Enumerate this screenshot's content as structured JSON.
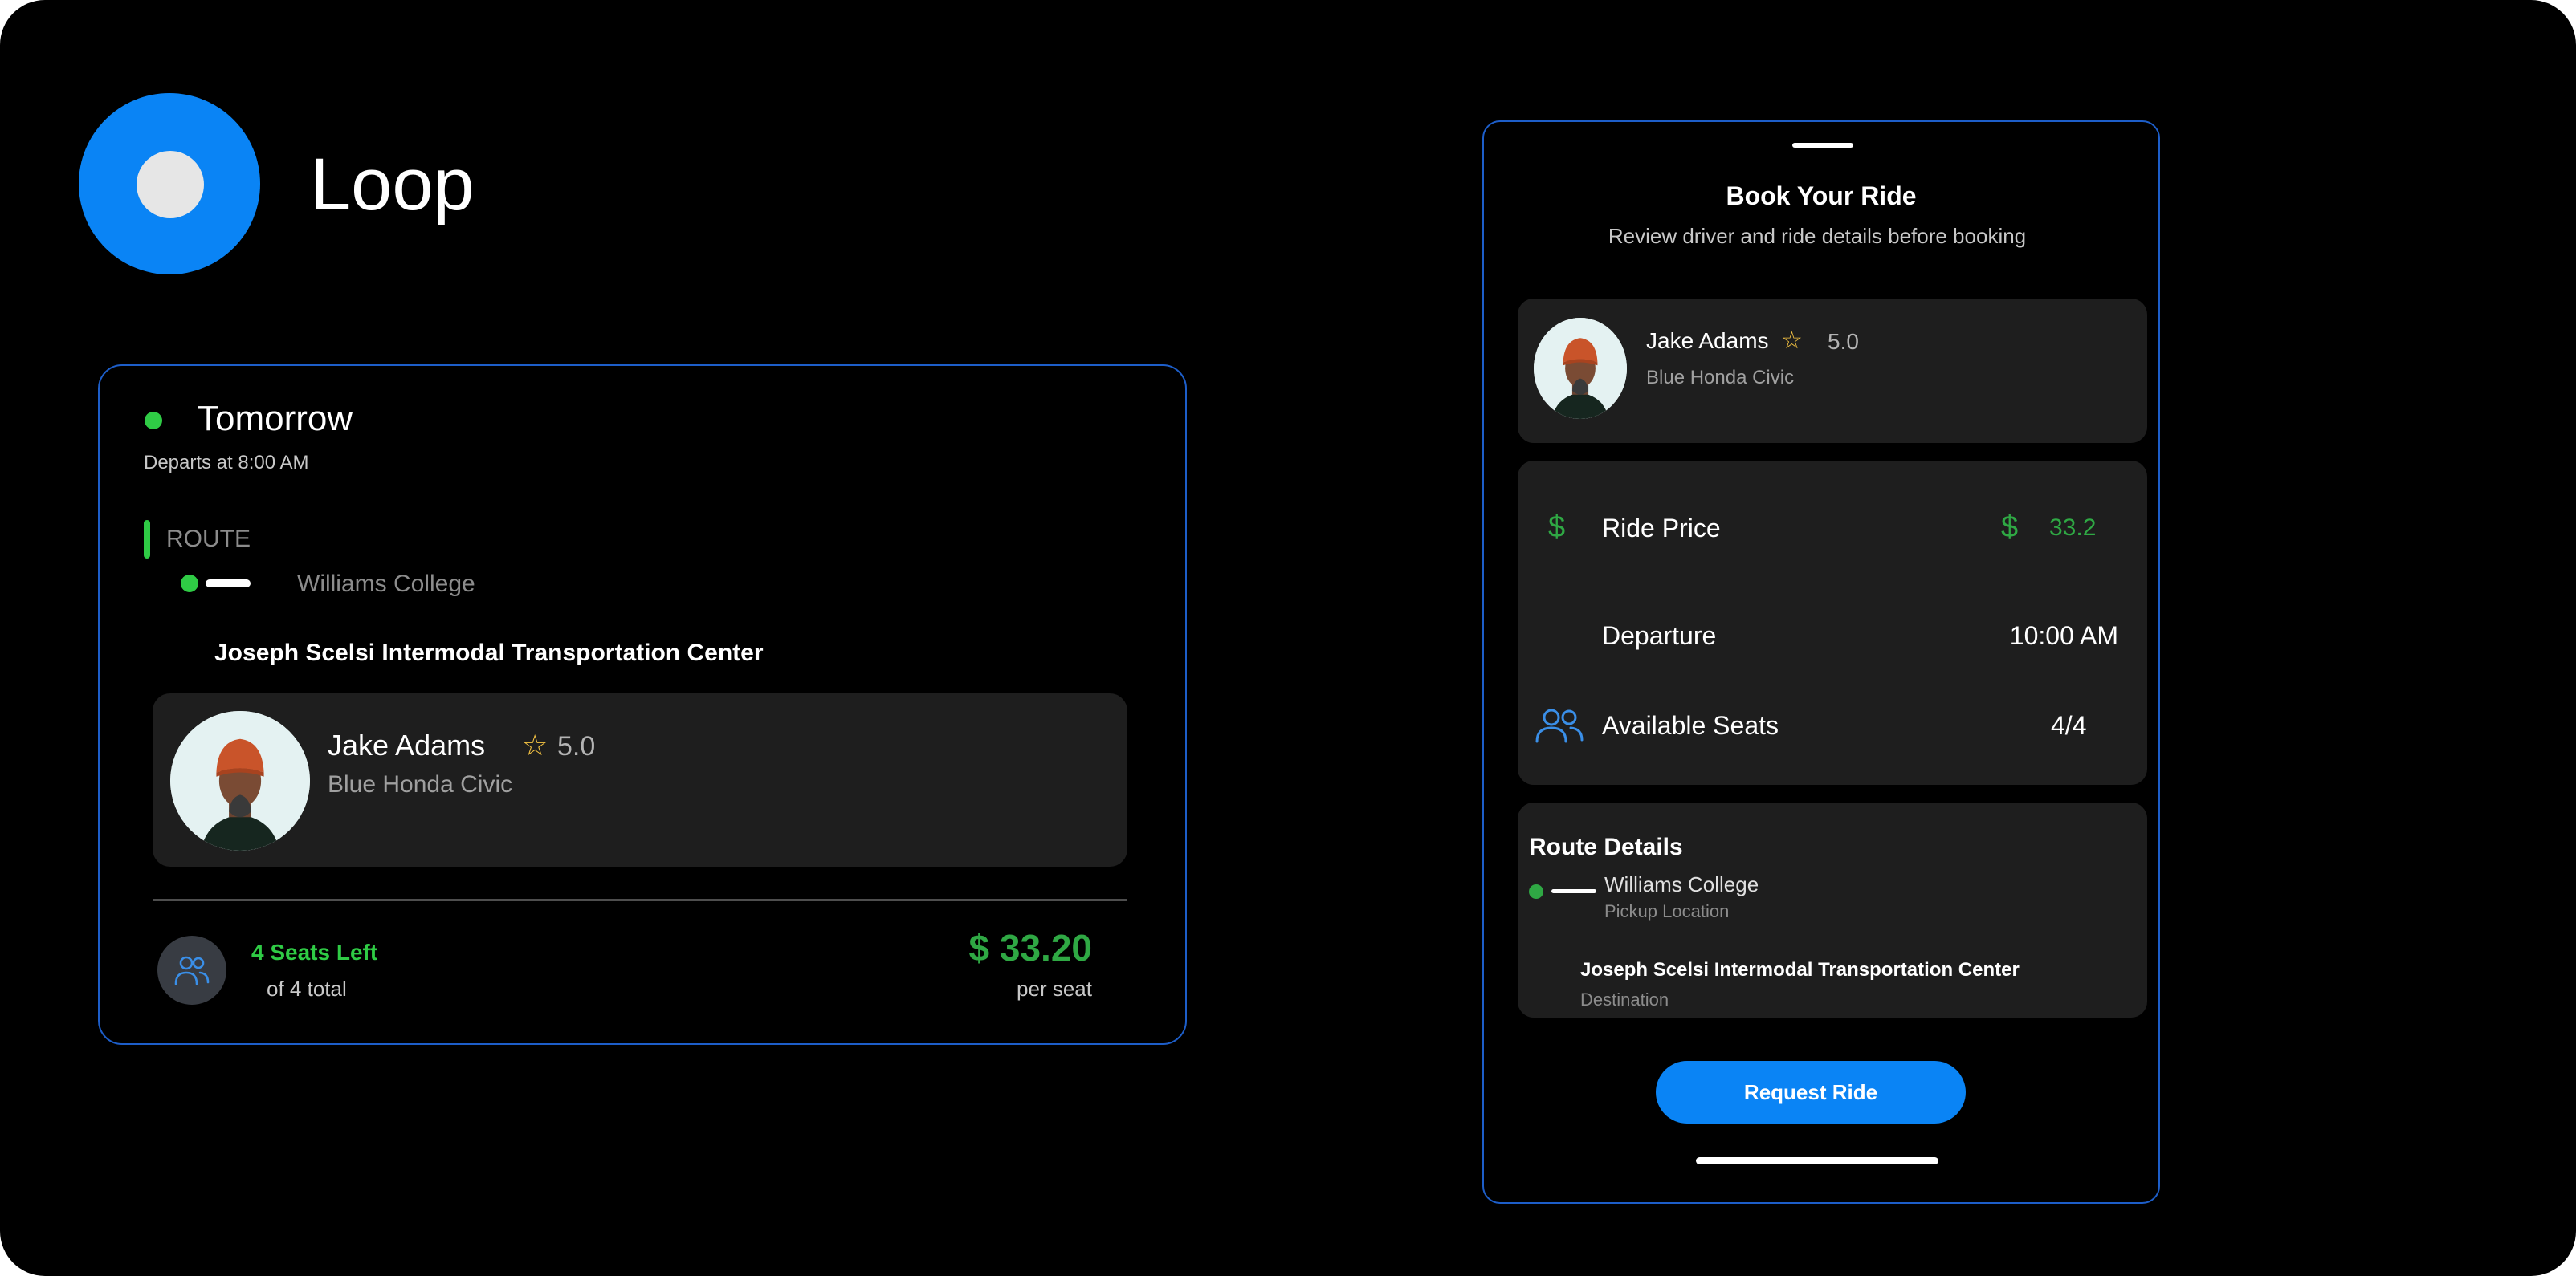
{
  "app": {
    "title": "Loop"
  },
  "ride_card": {
    "day": "Tomorrow",
    "departs": "Departs at 8:00 AM",
    "route_label": "ROUTE",
    "origin": "Williams College",
    "destination": "Joseph Scelsi Intermodal Transportation Center",
    "driver": {
      "name": "Jake Adams",
      "star": "☆",
      "rating": "5.0",
      "car": "Blue Honda Civic"
    },
    "seats_left": "4 Seats Left",
    "seats_total": "of 4 total",
    "price": "$ 33.20",
    "price_unit": "per seat"
  },
  "booking": {
    "title": "Book Your Ride",
    "subtitle": "Review driver and ride details before booking",
    "driver": {
      "name": "Jake Adams",
      "star": "☆",
      "rating": "5.0",
      "car": "Blue Honda Civic"
    },
    "details": {
      "price_icon": "$",
      "price_label": "Ride Price",
      "price_currency": "$",
      "price_value": "33.2",
      "departure_label": "Departure",
      "departure_value": "10:00 AM",
      "seats_label": "Available Seats",
      "seats_value": "4/4"
    },
    "route": {
      "title": "Route Details",
      "origin": "Williams College",
      "origin_sub": "Pickup Location",
      "destination": "Joseph Scelsi Intermodal Transportation Center",
      "destination_sub": "Destination"
    },
    "request_button": "Request Ride"
  },
  "colors": {
    "background": "#000000",
    "accent_blue": "#0a84f5",
    "card_border": "#1d5ec9",
    "green": "#2fcb45",
    "price_green": "#2fa844",
    "panel": "#1e1e1e",
    "star": "#f6c443"
  },
  "icons": [
    "logo-icon",
    "star-icon",
    "dollar-icon",
    "users-icon",
    "avatar"
  ]
}
